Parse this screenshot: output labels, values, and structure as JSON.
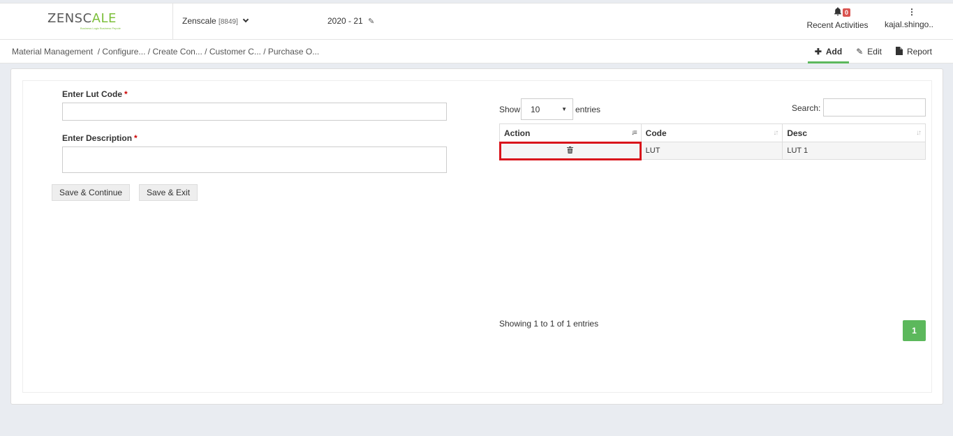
{
  "header": {
    "logo_main": "ZENSC",
    "logo_accent": "ALE",
    "logo_tagline": "Business Logic Business Pepole",
    "company_name": "Zenscale",
    "company_code": "[8849]",
    "fiscal_year": "2020 - 21",
    "activities_badge": "0",
    "activities_label": "Recent Activities",
    "user_name": "kajal.shingo.."
  },
  "breadcrumb": {
    "items": [
      "Material Management",
      "/ Configure...",
      "/ Create Con...",
      "/ Customer C...",
      "/ Purchase O..."
    ]
  },
  "actions": {
    "add_label": "Add",
    "edit_label": "Edit",
    "report_label": "Report"
  },
  "form": {
    "lut_code_label": "Enter Lut Code",
    "lut_code_value": "",
    "description_label": "Enter Description",
    "description_value": "",
    "required_mark": "*",
    "save_continue_label": "Save & Continue",
    "save_exit_label": "Save & Exit"
  },
  "table": {
    "show_label": "Show",
    "page_size": "10",
    "entries_label": "entries",
    "search_label": "Search:",
    "search_value": "",
    "columns": [
      "Action",
      "Code",
      "Desc"
    ],
    "rows": [
      {
        "code": "LUT",
        "desc": "LUT 1"
      }
    ],
    "showing_text": "Showing 1 to 1 of 1 entries",
    "current_page": "1"
  },
  "colors": {
    "accent_green": "#5cb85c",
    "brand_green": "#7cbf3a",
    "highlight_red": "#d9141b",
    "badge_red": "#d9534f"
  }
}
